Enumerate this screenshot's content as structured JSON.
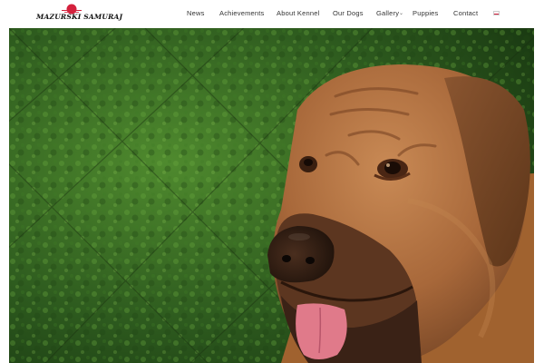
{
  "site": {
    "logo_text": "MAZURSKI SAMURAJ"
  },
  "nav": {
    "items": [
      {
        "label": "News"
      },
      {
        "label": "Achievements"
      },
      {
        "label": "About Kennel"
      },
      {
        "label": "Our Dogs"
      },
      {
        "label": "Gallery",
        "has_dropdown": true
      },
      {
        "label": "Puppies"
      },
      {
        "label": "Contact"
      }
    ],
    "language": "Polish"
  },
  "colors": {
    "brand_red": "#d4213d",
    "text": "#333333"
  },
  "hero": {
    "subject": "dog"
  }
}
